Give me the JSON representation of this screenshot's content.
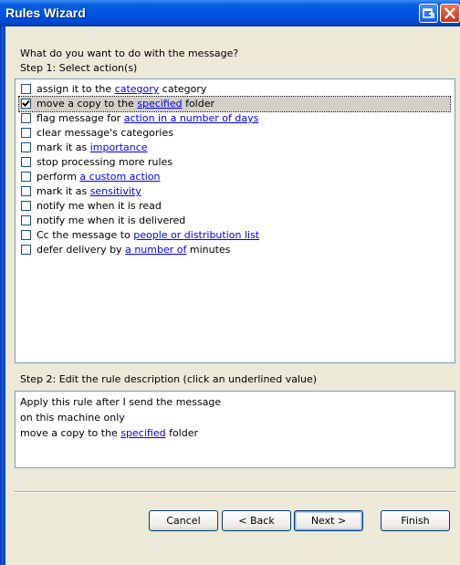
{
  "window": {
    "title": "Rules Wizard"
  },
  "prompt": "What do you want to do with the message?",
  "step1_label": "Step 1: Select action(s)",
  "actions": [
    {
      "before": "assign it to the ",
      "link": "category",
      "after": " category",
      "checked": false
    },
    {
      "before": "move a copy to the ",
      "link": "specified",
      "after": " folder",
      "checked": true
    },
    {
      "before": "flag message for ",
      "link": "action in a number of days",
      "after": "",
      "checked": false
    },
    {
      "before": "clear message's categories",
      "link": "",
      "after": "",
      "checked": false
    },
    {
      "before": "mark it as ",
      "link": "importance",
      "after": "",
      "checked": false
    },
    {
      "before": "stop processing more rules",
      "link": "",
      "after": "",
      "checked": false
    },
    {
      "before": "perform ",
      "link": "a custom action",
      "after": "",
      "checked": false
    },
    {
      "before": "mark it as ",
      "link": "sensitivity",
      "after": "",
      "checked": false
    },
    {
      "before": "notify me when it is read",
      "link": "",
      "after": "",
      "checked": false
    },
    {
      "before": "notify me when it is delivered",
      "link": "",
      "after": "",
      "checked": false
    },
    {
      "before": "Cc the message to ",
      "link": "people or distribution list",
      "after": "",
      "checked": false
    },
    {
      "before": "defer delivery by ",
      "link": "a number of",
      "after": " minutes",
      "checked": false
    }
  ],
  "step2_label": "Step 2: Edit the rule description (click an underlined value)",
  "description": {
    "line1": "Apply this rule after I send the message",
    "line2": "on this machine only",
    "line3_before": "move a copy to the ",
    "line3_link": "specified",
    "line3_after": " folder"
  },
  "buttons": {
    "cancel": "Cancel",
    "back": "< Back",
    "next": "Next >",
    "finish": "Finish"
  },
  "colors": {
    "titlebar": "#0054e3",
    "link": "#0000ff",
    "dialog_bg": "#ece9d8"
  }
}
